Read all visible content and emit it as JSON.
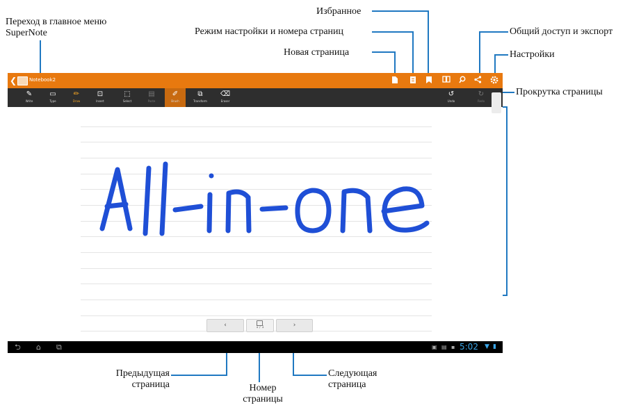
{
  "annotations": {
    "main_menu": "Переход в главное меню SuperNote",
    "favorites": "Избранное",
    "edit_mode": "Режим настройки и номера страниц",
    "new_page": "Новая страница",
    "share_export": "Общий доступ и экспорт",
    "settings": "Настройки",
    "page_scroll": "Прокрутка страницы",
    "prev_page": "Предыдущая страница",
    "page_number": "Номер страницы",
    "next_page": "Следующая страница"
  },
  "app": {
    "notebook_title": "Notebook2",
    "handwriting": "All-in-one"
  },
  "toolbar": {
    "tools": [
      "Write",
      "Type",
      "Draw",
      "Insert",
      "Select",
      "Paste",
      "Brush",
      "Transform",
      "Eraser"
    ],
    "undo": "Undo",
    "redo": "Redo"
  },
  "pagination": {
    "current": "1",
    "total": "1",
    "prev_glyph": "‹",
    "next_glyph": "›"
  },
  "statusbar": {
    "time": "5:02"
  },
  "colors": {
    "accent": "#e8790f",
    "annotation_lines": "#1f78c1",
    "ink": "#1f4fd6"
  },
  "icons": [
    "back-chevron-icon",
    "notebook-icon",
    "new-page-icon",
    "edit-mode-icon",
    "favorite-icon",
    "book-icon",
    "search-icon",
    "share-icon",
    "settings-icon",
    "undo-icon",
    "redo-icon",
    "home-icon",
    "recent-apps-icon",
    "wifi-icon",
    "battery-icon"
  ]
}
